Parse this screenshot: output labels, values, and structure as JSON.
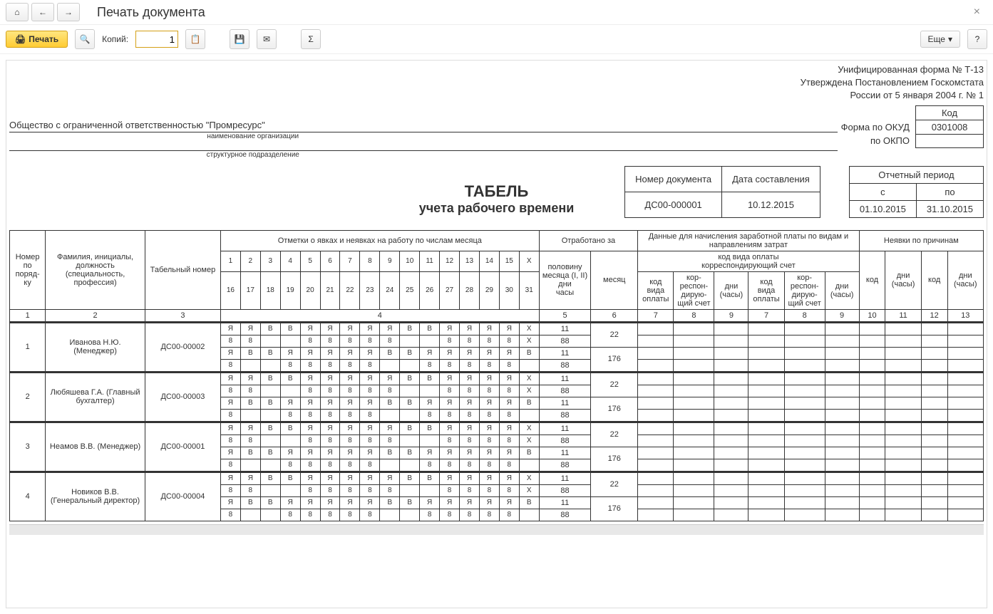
{
  "window": {
    "title": "Печать документа"
  },
  "toolbar": {
    "print": "Печать",
    "copies_label": "Копий:",
    "copies_value": "1",
    "more": "Еще",
    "help": "?"
  },
  "header": {
    "line1": "Унифицированная форма № Т-13",
    "line2": "Утверждена Постановлением Госкомстата",
    "line3": "России от 5 января 2004 г. № 1",
    "code_label": "Код",
    "okud_label": "Форма по ОКУД",
    "okud_value": "0301008",
    "okpo_label": "по ОКПО",
    "okpo_value": ""
  },
  "org": {
    "name": "Общество с ограниченной ответственностью \"Промресурс\"",
    "caption": "наименование организации",
    "sub_caption": "структурное подразделение"
  },
  "meta": {
    "doc_num_label": "Номер документа",
    "doc_date_label": "Дата составления",
    "doc_num": "ДС00-000001",
    "doc_date": "10.12.2015",
    "period_label": "Отчетный период",
    "from_label": "с",
    "to_label": "по",
    "from": "01.10.2015",
    "to": "31.10.2015"
  },
  "title": {
    "main": "ТАБЕЛЬ",
    "sub": "учета  рабочего времени"
  },
  "cols": {
    "num": "Номер по поряд-ку",
    "fio": "Фамилия, инициалы, должность (специальность, профессия)",
    "tab": "Табельный номер",
    "marks": "Отметки о явках и неявках на работу по числам месяца",
    "worked": "Отработано за",
    "half": "половину месяца (I, II)",
    "month": "месяц",
    "days": "дни",
    "hours": "часы",
    "payroll": "Данные для начисления заработной платы по видам и направлениям затрат",
    "paycode": "код вида оплаты",
    "corr": "корреспондирующий счет",
    "code_kind": "код вида оплаты",
    "corr_acc": "кор-респон-дирую-щий счет",
    "dh": "дни (часы)",
    "absent": "Неявки по причинам",
    "code": "код"
  },
  "colnums": [
    "1",
    "2",
    "3",
    "4",
    "5",
    "6",
    "7",
    "8",
    "9",
    "7",
    "8",
    "9",
    "10",
    "11",
    "12",
    "13"
  ],
  "days1": [
    "1",
    "2",
    "3",
    "4",
    "5",
    "6",
    "7",
    "8",
    "9",
    "10",
    "11",
    "12",
    "13",
    "14",
    "15",
    "X"
  ],
  "days2": [
    "16",
    "17",
    "18",
    "19",
    "20",
    "21",
    "22",
    "23",
    "24",
    "25",
    "26",
    "27",
    "28",
    "29",
    "30",
    "31"
  ],
  "employees": [
    {
      "num": "1",
      "fio": "Иванова Н.Ю. (Менеджер)",
      "tab": "ДС00-00002",
      "r1": [
        "Я",
        "Я",
        "В",
        "В",
        "Я",
        "Я",
        "Я",
        "Я",
        "Я",
        "В",
        "В",
        "Я",
        "Я",
        "Я",
        "Я",
        "X"
      ],
      "r2": [
        "8",
        "8",
        "",
        "",
        "8",
        "8",
        "8",
        "8",
        "8",
        "",
        "",
        "8",
        "8",
        "8",
        "8",
        "X"
      ],
      "r3": [
        "Я",
        "В",
        "В",
        "Я",
        "Я",
        "Я",
        "Я",
        "Я",
        "В",
        "В",
        "Я",
        "Я",
        "Я",
        "Я",
        "Я",
        "В"
      ],
      "r4": [
        "8",
        "",
        "",
        "8",
        "8",
        "8",
        "8",
        "8",
        "",
        "",
        "8",
        "8",
        "8",
        "8",
        "8",
        ""
      ],
      "half1": "11",
      "half2": "88",
      "half3": "11",
      "half4": "88",
      "month1": "22",
      "month2": "176"
    },
    {
      "num": "2",
      "fio": "Любяшева Г.А. (Главный бухгалтер)",
      "tab": "ДС00-00003",
      "r1": [
        "Я",
        "Я",
        "В",
        "В",
        "Я",
        "Я",
        "Я",
        "Я",
        "Я",
        "В",
        "В",
        "Я",
        "Я",
        "Я",
        "Я",
        "X"
      ],
      "r2": [
        "8",
        "8",
        "",
        "",
        "8",
        "8",
        "8",
        "8",
        "8",
        "",
        "",
        "8",
        "8",
        "8",
        "8",
        "X"
      ],
      "r3": [
        "Я",
        "В",
        "В",
        "Я",
        "Я",
        "Я",
        "Я",
        "Я",
        "В",
        "В",
        "Я",
        "Я",
        "Я",
        "Я",
        "Я",
        "В"
      ],
      "r4": [
        "8",
        "",
        "",
        "8",
        "8",
        "8",
        "8",
        "8",
        "",
        "",
        "8",
        "8",
        "8",
        "8",
        "8",
        ""
      ],
      "half1": "11",
      "half2": "88",
      "half3": "11",
      "half4": "88",
      "month1": "22",
      "month2": "176"
    },
    {
      "num": "3",
      "fio": "Неамов В.В. (Менеджер)",
      "tab": "ДС00-00001",
      "r1": [
        "Я",
        "Я",
        "В",
        "В",
        "Я",
        "Я",
        "Я",
        "Я",
        "Я",
        "В",
        "В",
        "Я",
        "Я",
        "Я",
        "Я",
        "X"
      ],
      "r2": [
        "8",
        "8",
        "",
        "",
        "8",
        "8",
        "8",
        "8",
        "8",
        "",
        "",
        "8",
        "8",
        "8",
        "8",
        "X"
      ],
      "r3": [
        "Я",
        "В",
        "В",
        "Я",
        "Я",
        "Я",
        "Я",
        "Я",
        "В",
        "В",
        "Я",
        "Я",
        "Я",
        "Я",
        "Я",
        "В"
      ],
      "r4": [
        "8",
        "",
        "",
        "8",
        "8",
        "8",
        "8",
        "8",
        "",
        "",
        "8",
        "8",
        "8",
        "8",
        "8",
        ""
      ],
      "half1": "11",
      "half2": "88",
      "half3": "11",
      "half4": "88",
      "month1": "22",
      "month2": "176"
    },
    {
      "num": "4",
      "fio": "Новиков В.В. (Генеральный директор)",
      "tab": "ДС00-00004",
      "r1": [
        "Я",
        "Я",
        "В",
        "В",
        "Я",
        "Я",
        "Я",
        "Я",
        "Я",
        "В",
        "В",
        "Я",
        "Я",
        "Я",
        "Я",
        "X"
      ],
      "r2": [
        "8",
        "8",
        "",
        "",
        "8",
        "8",
        "8",
        "8",
        "8",
        "",
        "",
        "8",
        "8",
        "8",
        "8",
        "X"
      ],
      "r3": [
        "Я",
        "В",
        "В",
        "Я",
        "Я",
        "Я",
        "Я",
        "Я",
        "В",
        "В",
        "Я",
        "Я",
        "Я",
        "Я",
        "Я",
        "В"
      ],
      "r4": [
        "8",
        "",
        "",
        "8",
        "8",
        "8",
        "8",
        "8",
        "",
        "",
        "8",
        "8",
        "8",
        "8",
        "8",
        ""
      ],
      "half1": "11",
      "half2": "88",
      "half3": "11",
      "half4": "88",
      "month1": "22",
      "month2": "176"
    }
  ]
}
